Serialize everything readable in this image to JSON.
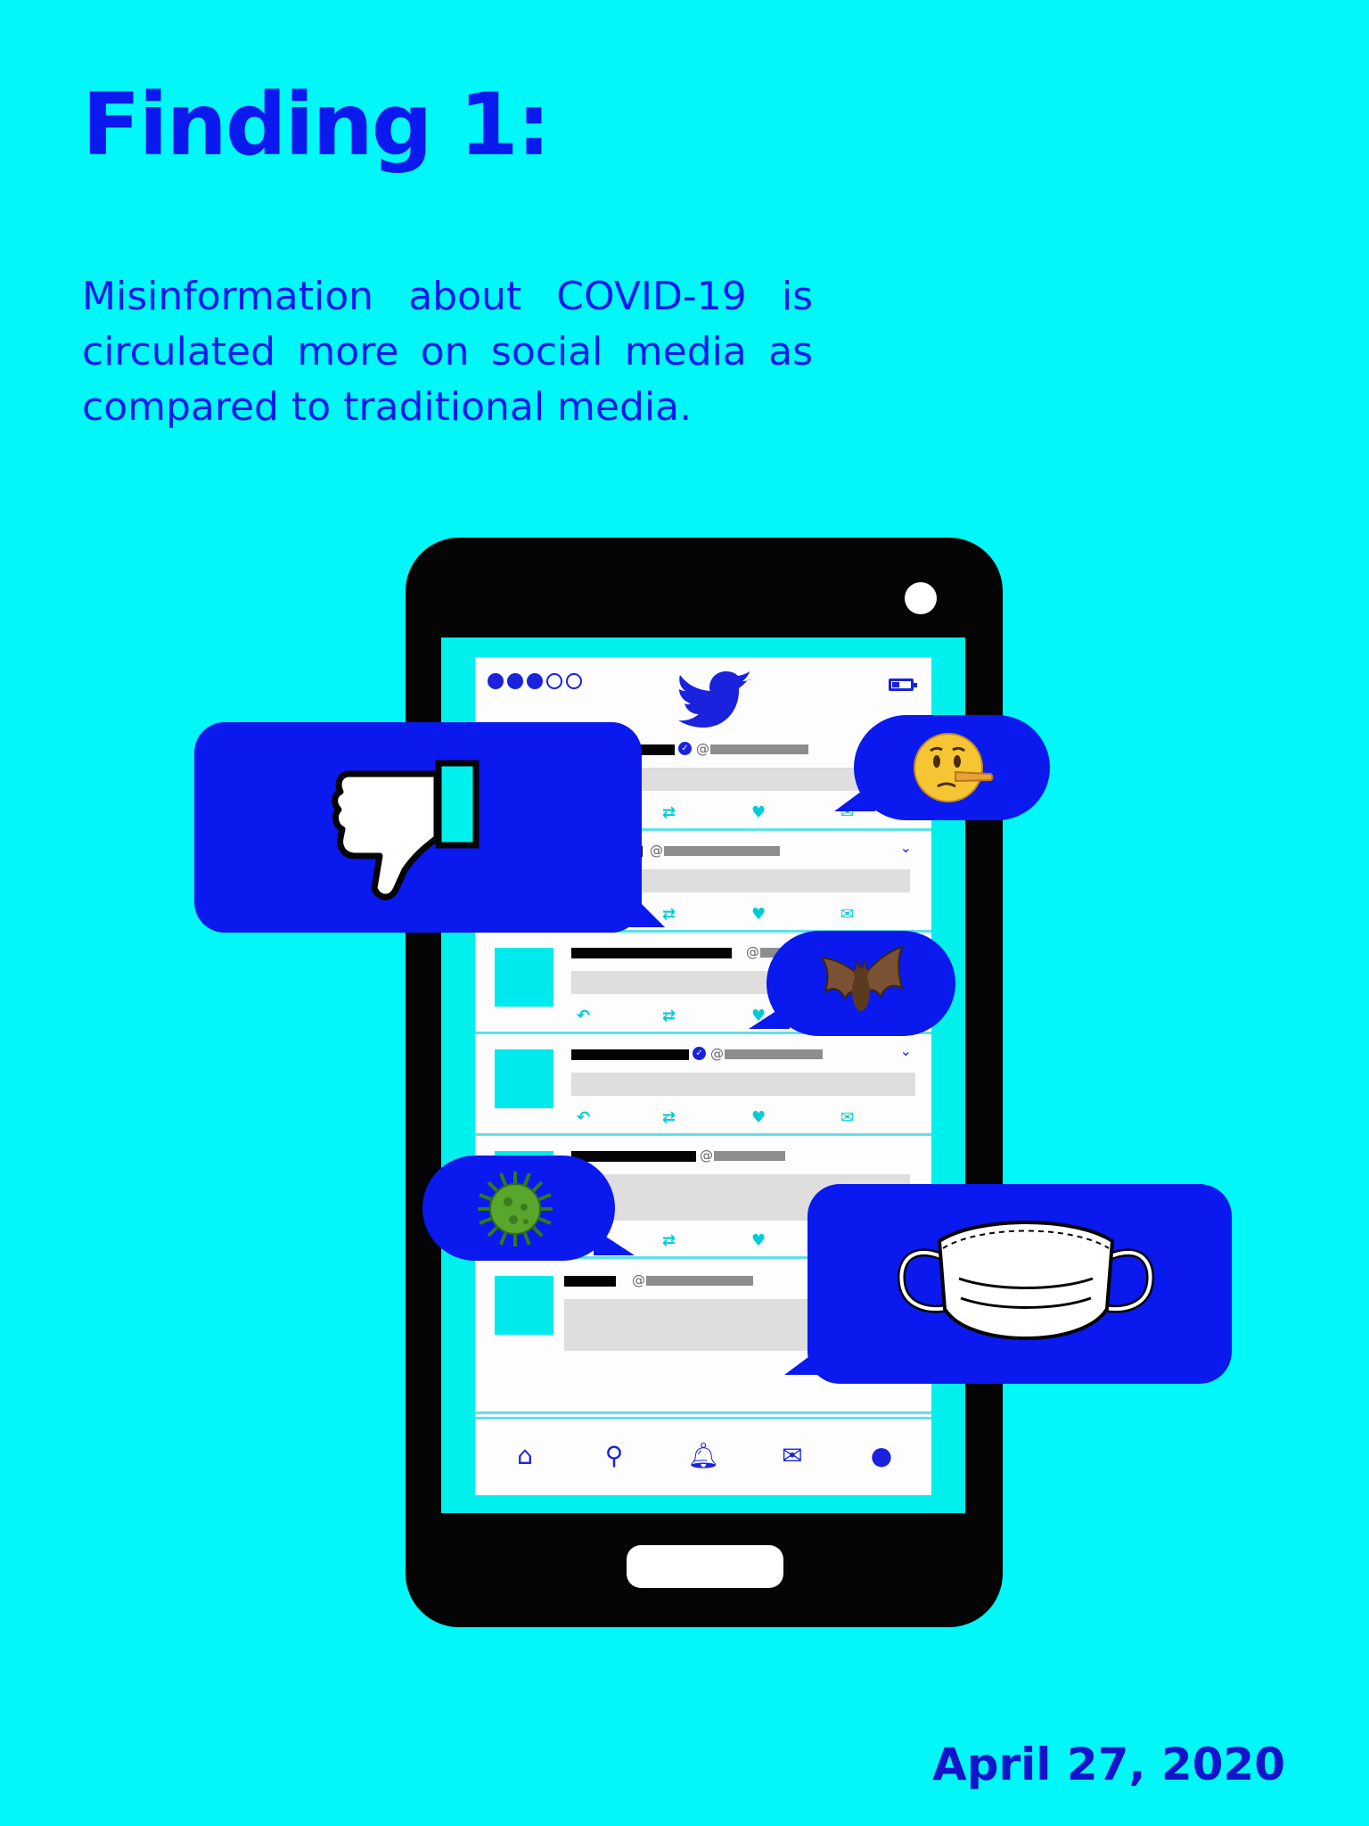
{
  "header": {
    "title": "Finding 1:",
    "subtitle": "Misinformation about COVID-19 is circulated more on social media as compared to traditional media."
  },
  "footer": {
    "date": "April 27, 2020"
  },
  "feed": {
    "handle_symbol": "@",
    "tweet_count": 6
  },
  "icons": {
    "app_logo": "twitter-bird-icon",
    "bubbles": [
      "thumbs-down-icon",
      "lying-face-icon",
      "bat-icon",
      "virus-icon",
      "face-mask-icon"
    ],
    "nav": [
      "home-icon",
      "search-icon",
      "notifications-icon",
      "messages-icon",
      "profile-icon"
    ]
  },
  "colors": {
    "background": "#00f8f8",
    "accent": "#0a19ee",
    "phone": "#040404"
  }
}
